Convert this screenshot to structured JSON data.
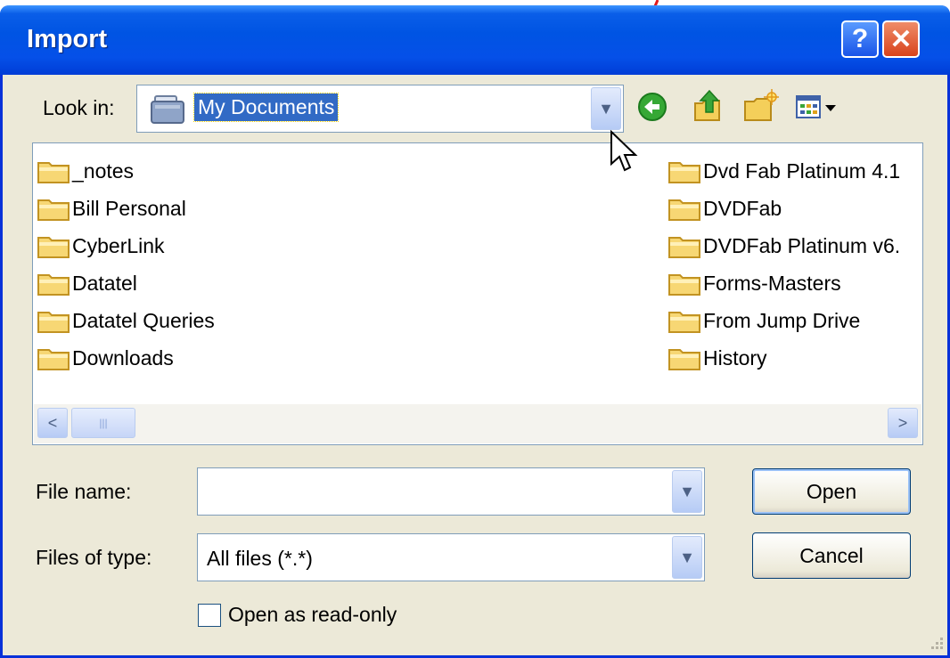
{
  "colors": {
    "title_bar": "#0054e3",
    "dialog_bg": "#ece9d8",
    "selection": "#316ac5",
    "annotation": "#e31a1c"
  },
  "dialog": {
    "title": "Import",
    "help_button": "?",
    "close_button": "✕"
  },
  "lookin": {
    "label": "Look in:",
    "value": "My Documents",
    "icon": "my-documents-icon",
    "dropdown_icon": "chevron-down-icon"
  },
  "toolbar": {
    "icons": [
      "back-icon",
      "up-folder-icon",
      "new-folder-icon",
      "view-menu-icon"
    ]
  },
  "file_list": {
    "column1": [
      "_notes",
      "Bill Personal",
      "CyberLink",
      "Datatel",
      "Datatel Queries",
      "Downloads"
    ],
    "column2": [
      "Dvd Fab Platinum 4.1",
      "DVDFab",
      "DVDFab Platinum v6.",
      "Forms-Masters",
      "From Jump Drive",
      "History"
    ]
  },
  "scrollbar": {
    "left": "<",
    "right": ">"
  },
  "file_name": {
    "label": "File name:",
    "value": ""
  },
  "files_of_type": {
    "label": "Files of type:",
    "value": "All files (*.*)"
  },
  "buttons": {
    "open": "Open",
    "cancel": "Cancel"
  },
  "read_only": {
    "label": "Open as read-only",
    "checked": false
  }
}
